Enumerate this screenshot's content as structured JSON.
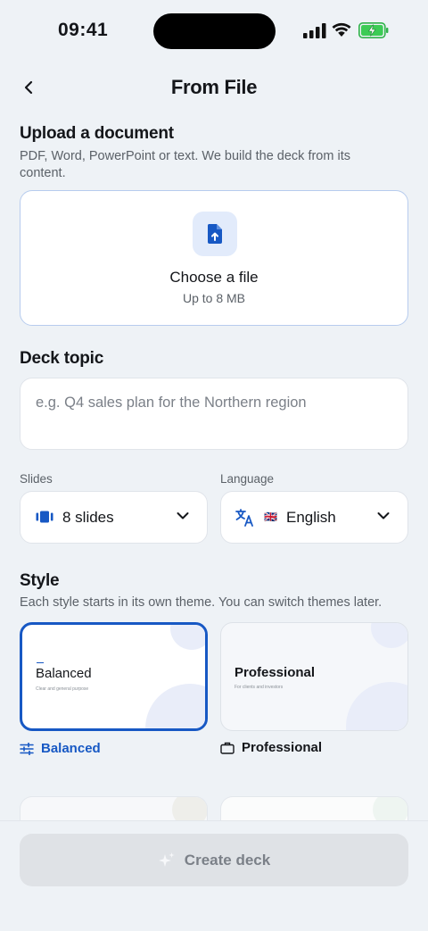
{
  "status_bar": {
    "time": "09:41"
  },
  "header": {
    "title": "From File"
  },
  "upload": {
    "heading": "Upload a document",
    "description": "PDF, Word, PowerPoint or text. We build the deck from its content.",
    "card_title": "Choose a file",
    "card_subtitle": "Up to 8 MB"
  },
  "topic": {
    "heading": "Deck topic",
    "placeholder": "e.g. Q4 sales plan for the Northern region",
    "value": ""
  },
  "slides": {
    "label": "Slides",
    "value": "8 slides"
  },
  "language": {
    "label": "Language",
    "flag": "🇬🇧",
    "value": "English"
  },
  "style": {
    "heading": "Style",
    "description": "Each style starts in its own theme. You can switch themes later.",
    "options": [
      {
        "name": "Balanced",
        "preview_title": "Balanced",
        "preview_sub": "Clear and general purpose",
        "selected": true,
        "icon": "sliders-icon"
      },
      {
        "name": "Professional",
        "preview_title": "Professional",
        "preview_sub": "For clients and investors",
        "selected": false,
        "icon": "briefcase-icon"
      }
    ]
  },
  "footer": {
    "create_label": "Create deck"
  },
  "colors": {
    "accent": "#1758c4",
    "background": "#eef2f6",
    "disabled": "#dfe2e6"
  }
}
